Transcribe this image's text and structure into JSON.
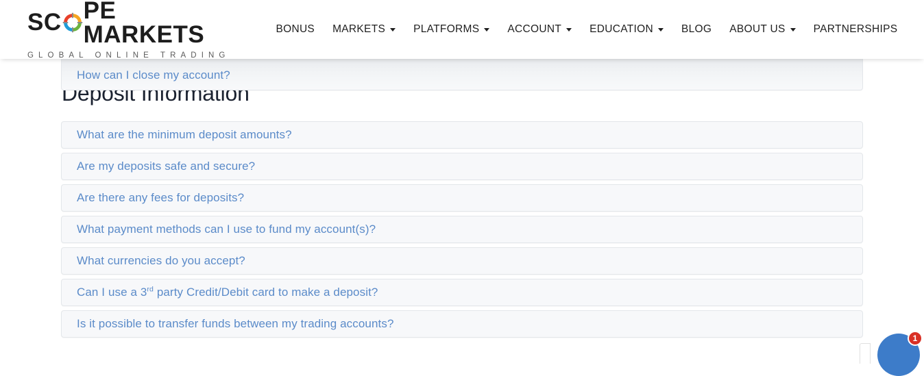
{
  "header": {
    "logo": {
      "text_before_ring": "SC",
      "ring_icon": "scope-ring-icon",
      "text_after_ring": "PE MARKETS",
      "tagline": "GLOBAL ONLINE TRADING",
      "ring_colors": {
        "top_left": "#e8402a",
        "top_right": "#f5a623",
        "bottom_right": "#6cb33f",
        "bottom_left": "#1f9cd8",
        "ticks": "#888888"
      }
    },
    "nav": [
      {
        "label": "BONUS",
        "has_dropdown": false
      },
      {
        "label": "MARKETS",
        "has_dropdown": true
      },
      {
        "label": "PLATFORMS",
        "has_dropdown": true
      },
      {
        "label": "ACCOUNT",
        "has_dropdown": true
      },
      {
        "label": "EDUCATION",
        "has_dropdown": true
      },
      {
        "label": "BLOG",
        "has_dropdown": false
      },
      {
        "label": "ABOUT US",
        "has_dropdown": true
      },
      {
        "label": "PARTNERSHIPS",
        "has_dropdown": false
      }
    ]
  },
  "main": {
    "partial_item_above": {
      "question": "How can I close my account?"
    },
    "section_title": "Deposit Information",
    "faq_items": [
      {
        "question": "What are the minimum deposit amounts?"
      },
      {
        "question": "Are my deposits safe and secure?"
      },
      {
        "question": "Are there any fees for deposits?"
      },
      {
        "question": "What payment methods can I use to fund my account(s)?"
      },
      {
        "question": "What currencies do you accept?"
      },
      {
        "question_pre": "Can I use a 3",
        "question_sup": "rd",
        "question_post": " party Credit/Debit card to make a deposit?"
      },
      {
        "question": "Is it possible to transfer funds between my trading accounts?"
      }
    ]
  },
  "chat_widget": {
    "badge_count": "1",
    "bubble_color": "#3d7cc9",
    "badge_color": "#d93025"
  },
  "colors": {
    "link_blue": "#5b8bc9",
    "heading_dark": "#1b2230",
    "card_bg": "#f7f8fa",
    "card_border": "#e3e6ea",
    "page_bg": "#ffffff"
  }
}
